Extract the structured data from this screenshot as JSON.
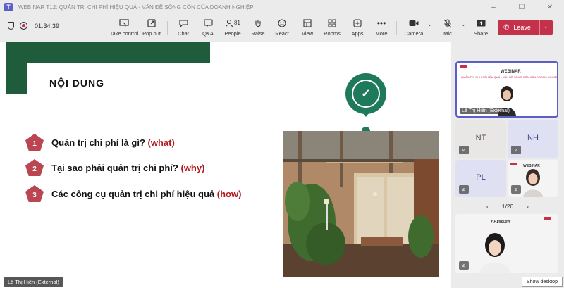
{
  "window": {
    "title": "WEBINAR T12: QUẢN TRỊ CHI PHÍ HIỆU QUẢ - VẤN ĐỀ SỐNG CÒN CỦA DOANH NGHIỆP",
    "controls": [
      "–",
      "☐",
      "✕"
    ]
  },
  "toolbar": {
    "timer": "01:34:39",
    "take_control": "Take control",
    "pop_out": "Pop out",
    "chat": "Chat",
    "qa": "Q&A",
    "people": "People",
    "people_count": "81",
    "raise": "Raise",
    "react": "React",
    "view": "View",
    "rooms": "Rooms",
    "apps": "Apps",
    "more": "More",
    "camera": "Camera",
    "mic": "Mic",
    "share": "Share",
    "leave": "Leave"
  },
  "slide": {
    "heading": "NỘI DUNG",
    "items": [
      {
        "num": "1",
        "text": "Quản trị chi phí là gì?",
        "tag": "(what)"
      },
      {
        "num": "2",
        "text": "Tại sao phải quản trị chi phí?",
        "tag": "(why)"
      },
      {
        "num": "3",
        "text": "Các công cụ quản trị chi phí hiệu quả",
        "tag": "(how)"
      }
    ]
  },
  "presenter": {
    "name": "Lê Thị Hiên (External)"
  },
  "participants": {
    "main_tile": {
      "name": "Lê Thị Hiên (External)",
      "slide_title": "WEBINAR",
      "slide_sub": "QUẢN TRỊ CHI PHÍ HIỆU QUẢ - VẤN ĐỀ SỐNG CÒN CỦA DOANH NGHIỆP"
    },
    "tiles": [
      {
        "initials": "NT",
        "bg": "#e6e0e0",
        "fg": "#6b4a4a"
      },
      {
        "initials": "NH",
        "bg": "#d9dcf2",
        "fg": "#3a3f8f"
      },
      {
        "initials": "PL",
        "bg": "#d9dcf2",
        "fg": "#3a3f8f"
      }
    ],
    "video_tile_title": "WEBINAR",
    "bottom_tile_title": "WEBINAR",
    "pager": "1/20"
  },
  "taskbar": {
    "show_desktop": "Show desktop"
  },
  "colors": {
    "accent": "#5b5fc7",
    "leave": "#c4314b",
    "slide_green": "#1e5c3c",
    "pentagon": "#b94651",
    "highlight": "#b3181f"
  }
}
